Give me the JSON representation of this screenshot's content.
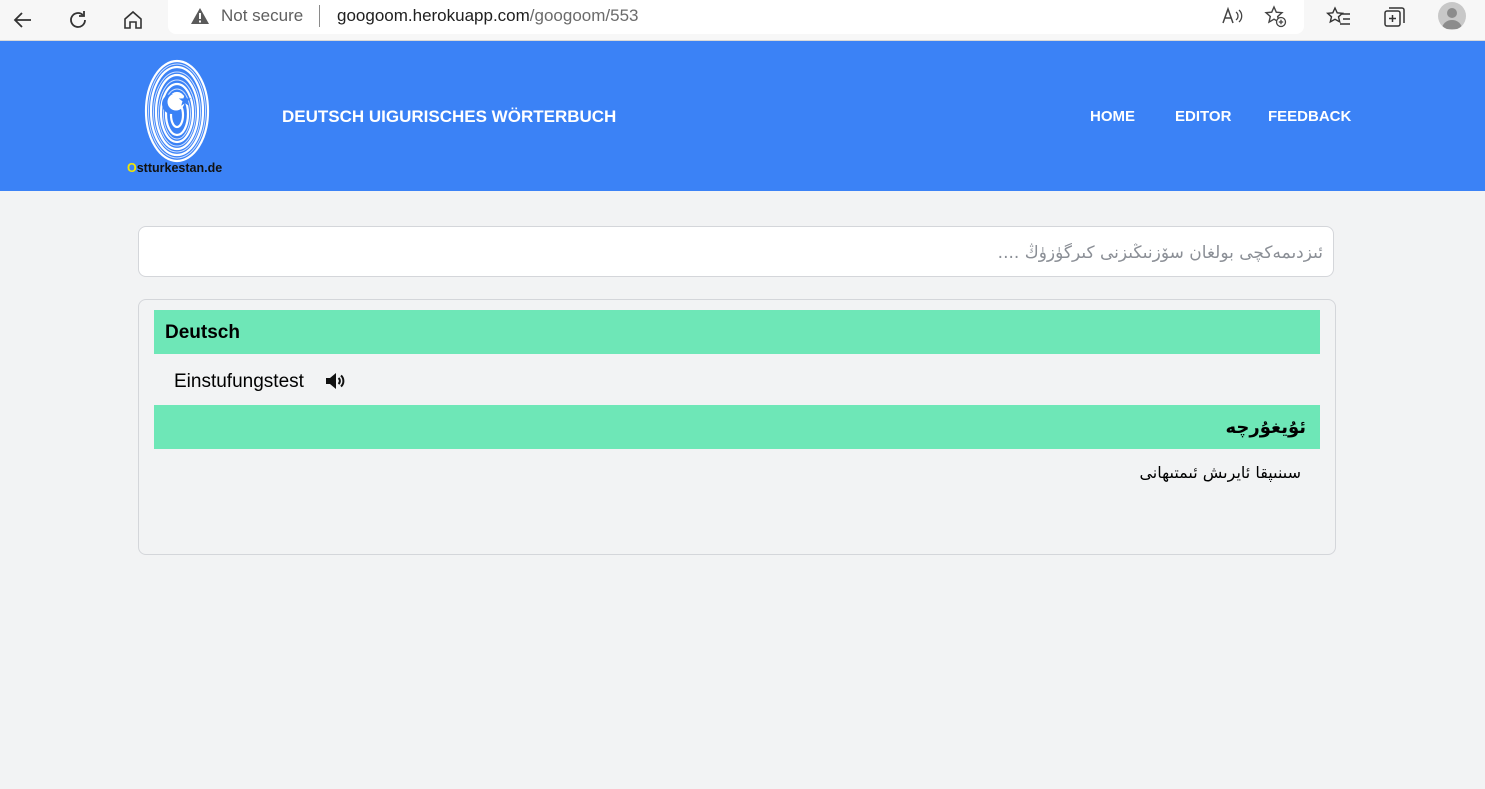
{
  "browser": {
    "not_secure_label": "Not secure",
    "url_host": "googoom.herokuapp.com",
    "url_path": "/googoom/553"
  },
  "header": {
    "logo_text_o": "O",
    "logo_text_rest": "stturkestan.de",
    "title": "DEUTSCH UIGURISCHES WÖRTERBUCH",
    "nav": [
      "HOME",
      "EDITOR",
      "FEEDBACK"
    ]
  },
  "search": {
    "placeholder": "ئىزدىمەكچى بولغان سۆزنىڭىزنى كىرگۈزۈڭ ...."
  },
  "result": {
    "german_header": "Deutsch",
    "german_word": "Einstufungstest",
    "uyghur_header": "ئۇيغۇرچە",
    "uyghur_translation": "سىنىپقا ئايرىش ئىمتىھانى"
  },
  "colors": {
    "header_bg": "#3b82f6",
    "band_bg": "#6ee7b7",
    "page_bg": "#f2f3f4"
  }
}
